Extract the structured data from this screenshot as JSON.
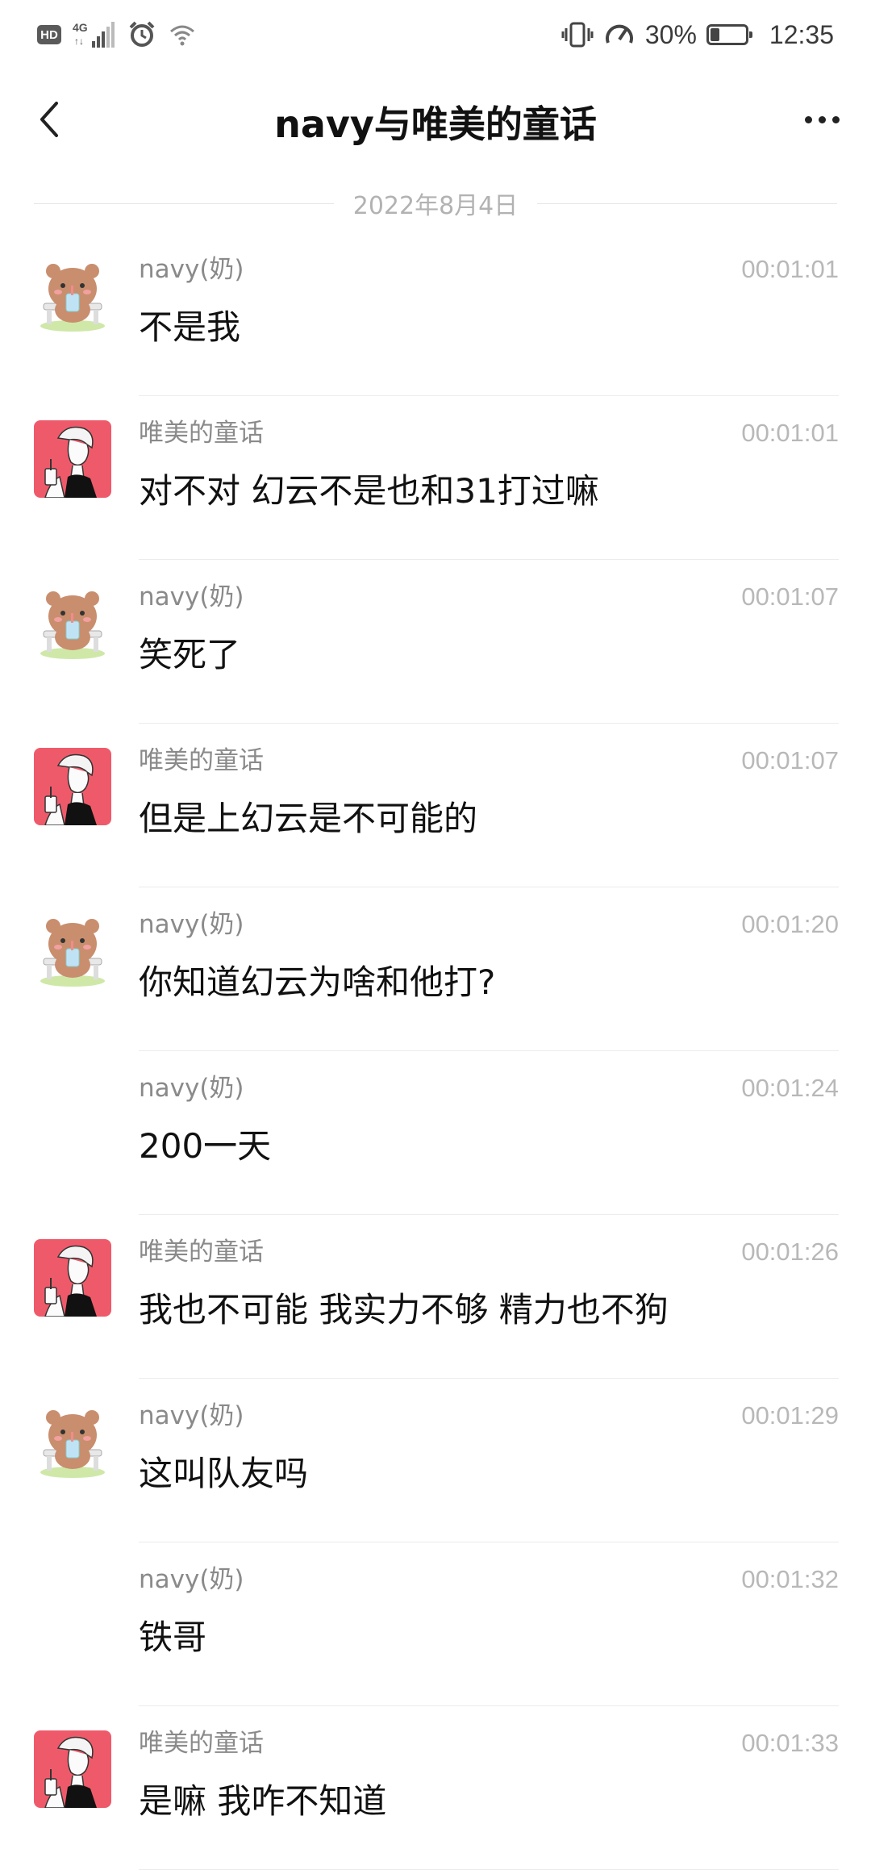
{
  "status_bar": {
    "hd_badge": "HD",
    "network": "4G",
    "battery_percent": "30%",
    "battery_level": 0.3,
    "time": "12:35"
  },
  "header": {
    "title": "navy与唯美的童话",
    "back_icon": "chevron-left-icon",
    "more_icon": "ellipsis-icon"
  },
  "date_divider": "2022年8月4日",
  "colors": {
    "bear_fur": "#c98e6e",
    "bear_avatar_bg": "#ffffff",
    "girl_avatar_bg": "#ef5a6a",
    "separator": "#ececec",
    "sender_text": "#8a8a8a",
    "time_text": "#b8b8b8"
  },
  "messages": [
    {
      "sender": "navy(奶)",
      "time": "00:01:01",
      "text": "不是我",
      "avatar": "bear"
    },
    {
      "sender": "唯美的童话",
      "time": "00:01:01",
      "text": "对不对 幻云不是也和31打过嘛",
      "avatar": "girl"
    },
    {
      "sender": "navy(奶)",
      "time": "00:01:07",
      "text": "笑死了",
      "avatar": "bear"
    },
    {
      "sender": "唯美的童话",
      "time": "00:01:07",
      "text": "但是上幻云是不可能的",
      "avatar": "girl"
    },
    {
      "sender": "navy(奶)",
      "time": "00:01:20",
      "text": "你知道幻云为啥和他打?",
      "avatar": "bear"
    },
    {
      "sender": "navy(奶)",
      "time": "00:01:24",
      "text": "200一天",
      "avatar": "none"
    },
    {
      "sender": "唯美的童话",
      "time": "00:01:26",
      "text": "我也不可能 我实力不够 精力也不狗",
      "avatar": "girl"
    },
    {
      "sender": "navy(奶)",
      "time": "00:01:29",
      "text": "这叫队友吗",
      "avatar": "bear"
    },
    {
      "sender": "navy(奶)",
      "time": "00:01:32",
      "text": "铁哥",
      "avatar": "none"
    },
    {
      "sender": "唯美的童话",
      "time": "00:01:33",
      "text": "是嘛 我咋不知道",
      "avatar": "girl"
    }
  ]
}
